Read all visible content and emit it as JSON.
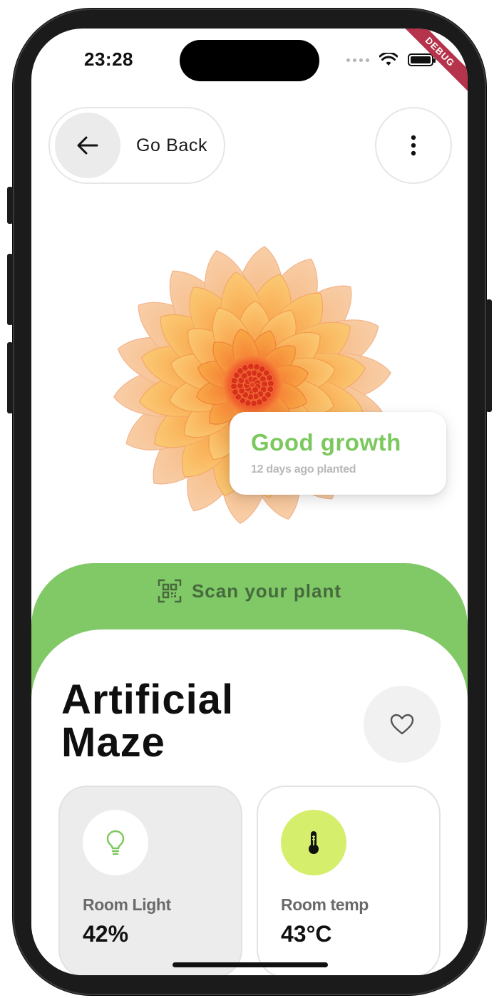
{
  "status_bar": {
    "time": "23:28",
    "debug_banner": "DEBUG"
  },
  "header": {
    "back_label": "Go Back"
  },
  "growth_card": {
    "title": "Good growth",
    "subtitle": "12 days ago planted"
  },
  "scan": {
    "label": "Scan your plant"
  },
  "plant": {
    "name_line1": "Artificial",
    "name_line2": "Maze"
  },
  "stats": [
    {
      "label": "Room Light",
      "value": "42%",
      "icon": "lightbulb-icon"
    },
    {
      "label": "Room temp",
      "value": "43°C",
      "icon": "thermometer-icon"
    }
  ],
  "colors": {
    "accent_green": "#80c966",
    "growth_text": "#7cc85e",
    "temp_icon_bg": "#d5ee6b",
    "debug_ribbon": "#b5344b"
  }
}
